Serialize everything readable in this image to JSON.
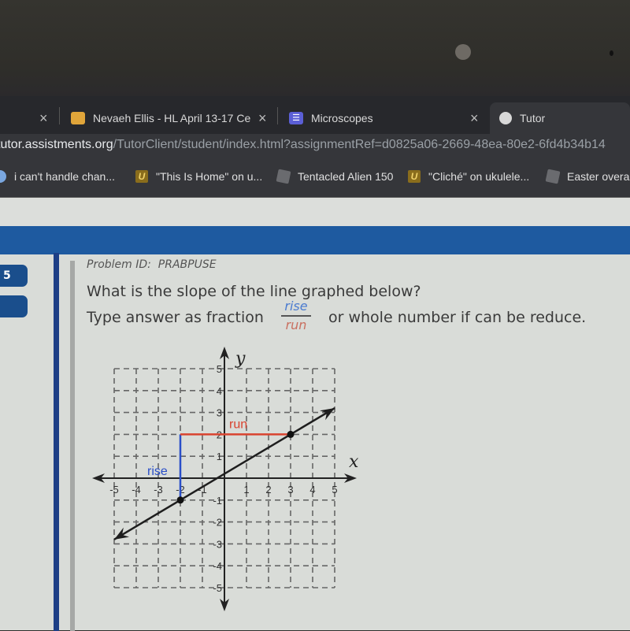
{
  "browser": {
    "tabs": [
      {
        "label": "",
        "close_label": "×"
      },
      {
        "label": "Nevaeh Ellis - HL April 13-17 Ce",
        "close_label": "×",
        "favicon": "classroom-icon",
        "favicon_color": "#e0a53a"
      },
      {
        "label": "Microscopes",
        "close_label": "×",
        "favicon": "list-icon",
        "favicon_color": "#5b5fd6"
      },
      {
        "label": "Tutor",
        "favicon": "globe-icon"
      }
    ],
    "address_bar": {
      "host": "tutor.assistments.org",
      "path": "/TutorClient/student/index.html?assignmentRef=d0825a06-2669-48ea-80e2-6fd4b34b14"
    },
    "bookmarks": [
      {
        "label": "i can't handle chan...",
        "icon": "globe-icon"
      },
      {
        "label": "\"This Is Home\" on u...",
        "icon": "ukulele-u-icon"
      },
      {
        "label": "Tentacled Alien 150",
        "icon": "roblox-icon"
      },
      {
        "label": "\"Cliché\" on ukulele...",
        "icon": "ukulele-u-icon"
      },
      {
        "label": "Easter overal",
        "icon": "roblox-icon"
      }
    ]
  },
  "sidebar": {
    "problem_number": "5",
    "second_button": ""
  },
  "problem": {
    "id_label": "Problem ID:",
    "id_value": "PRABPUSE",
    "question_line1": "What is the slope of the line graphed below?",
    "question_line2": "Type answer as fraction",
    "fraction_numerator": "rise",
    "fraction_denominator": "run",
    "question_line3": "or whole number if can be reduce."
  },
  "colors": {
    "navbar": "#1e5aa0",
    "rise": "#2a4fc9",
    "run": "#d9432f",
    "line": "#1e1e1e"
  },
  "chart_data": {
    "type": "line",
    "title": "",
    "xlabel": "x",
    "ylabel": "y",
    "xlim": [
      -5,
      5
    ],
    "ylim": [
      -5,
      5
    ],
    "grid": true,
    "grid_style": "dashed",
    "x_ticks": [
      "-5",
      "-4",
      "-3",
      "-2",
      "-1",
      "1",
      "2",
      "3",
      "4",
      "5"
    ],
    "y_ticks": [
      "5",
      "4",
      "3",
      "2",
      "1",
      "-1",
      "-2",
      "-3",
      "-4",
      "-5"
    ],
    "line": {
      "slope": 0.6,
      "intercept": 0.2,
      "x_range": [
        -5,
        5
      ],
      "arrows": "both"
    },
    "points": [
      {
        "x": -2,
        "y": -1
      },
      {
        "x": 3,
        "y": 2
      }
    ],
    "rise_segment": {
      "label": "rise",
      "from": {
        "x": -2,
        "y": -1
      },
      "to": {
        "x": -2,
        "y": 2
      }
    },
    "run_segment": {
      "label": "run",
      "from": {
        "x": -2,
        "y": 2
      },
      "to": {
        "x": 3,
        "y": 2
      }
    }
  }
}
